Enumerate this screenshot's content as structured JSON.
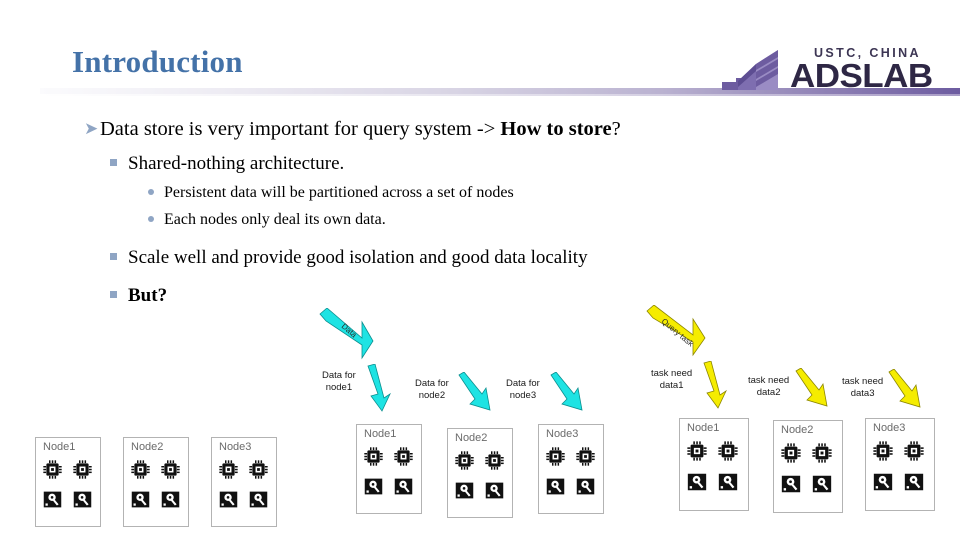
{
  "header": {
    "title": "Introduction",
    "logo": {
      "sub_text": "USTC, CHINA",
      "main_text": "ADSLAB",
      "mark_name": "adslab-stairs-logo",
      "accent_color": "#6d5ca0"
    },
    "rule_color_left": "#fbfbfd",
    "rule_color_right": "#6d5ca0"
  },
  "content": {
    "title_color": "#4472a8",
    "bullet_marker_color": "#8fa5c4",
    "bullets": [
      {
        "level": 1,
        "marker": "arrow",
        "text_plain": "Data store is very important for query system -> How to store?",
        "text_normal": "Data store is very important for query system -> ",
        "text_bold": "How to store",
        "text_tail": "?"
      },
      {
        "level": 2,
        "marker": "square",
        "text_plain": "Shared-nothing architecture."
      },
      {
        "level": 3,
        "marker": "dot",
        "text_plain": "Persistent data will be partitioned across a set of nodes"
      },
      {
        "level": 3,
        "marker": "dot",
        "text_plain": "Each nodes only deal its own data."
      },
      {
        "level": 2,
        "marker": "square",
        "text_plain": "Scale well and provide good isolation and good data locality"
      },
      {
        "level": 2,
        "marker": "square",
        "text_plain": "But?",
        "bold": true
      }
    ]
  },
  "diagram": {
    "groups": [
      {
        "id": "shared-nothing-base",
        "big_arrow": null,
        "nodes": [
          {
            "label": "Node1",
            "cpu_count": 2,
            "disk_count": 2
          },
          {
            "label": "Node2",
            "cpu_count": 2,
            "disk_count": 2
          },
          {
            "label": "Node3",
            "cpu_count": 2,
            "disk_count": 2
          }
        ],
        "arrow_labels": []
      },
      {
        "id": "data-partitioning",
        "big_arrow": {
          "label": "Data",
          "color": "#1ee3e3"
        },
        "nodes": [
          {
            "label": "Node1",
            "cpu_count": 2,
            "disk_count": 2
          },
          {
            "label": "Node2",
            "cpu_count": 2,
            "disk_count": 2
          },
          {
            "label": "Node3",
            "cpu_count": 2,
            "disk_count": 2
          }
        ],
        "arrow_labels": [
          {
            "line1": "Data for",
            "line2": "node1",
            "color": "#1ee3e3"
          },
          {
            "line1": "Data for",
            "line2": "node2",
            "color": "#1ee3e3"
          },
          {
            "line1": "Data for",
            "line2": "node3",
            "color": "#1ee3e3"
          }
        ]
      },
      {
        "id": "query-task-routing",
        "big_arrow": {
          "label": "Query task",
          "color": "#f5ec00"
        },
        "nodes": [
          {
            "label": "Node1",
            "cpu_count": 2,
            "disk_count": 2
          },
          {
            "label": "Node2",
            "cpu_count": 2,
            "disk_count": 2
          },
          {
            "label": "Node3",
            "cpu_count": 2,
            "disk_count": 2
          }
        ],
        "arrow_labels": [
          {
            "line1": "task need",
            "line2": "data1",
            "color": "#f5ec00"
          },
          {
            "line1": "task need",
            "line2": "data2",
            "color": "#f5ec00"
          },
          {
            "line1": "task need",
            "line2": "data3",
            "color": "#f5ec00"
          }
        ]
      }
    ],
    "icons": {
      "cpu": "cpu-chip-icon",
      "disk": "hard-disk-icon"
    }
  }
}
